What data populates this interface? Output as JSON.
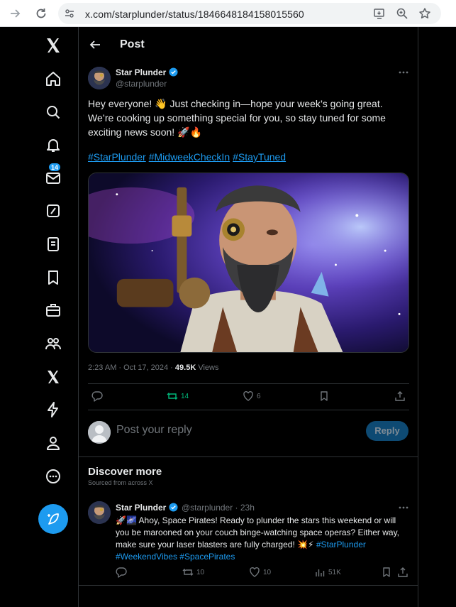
{
  "browser": {
    "url": "x.com/starplunder/status/1846648184158015560"
  },
  "sidebar": {
    "notification_count": "14"
  },
  "header": {
    "title": "Post"
  },
  "post": {
    "display_name": "Star Plunder",
    "handle": "@starplunder",
    "text": "Hey everyone! 👋 Just checking in—hope your week’s going great. We’re cooking up something special for you, so stay tuned for some exciting news soon! 🚀🔥",
    "hashtags": [
      "#StarPlunder",
      "#MidweekCheckIn",
      "#StayTuned"
    ],
    "timestamp": "2:23 AM · Oct 17, 2024 · ",
    "views_count": "49.5K",
    "views_label": " Views",
    "retweets": "14",
    "likes": "6"
  },
  "reply_box": {
    "placeholder": "Post your reply",
    "button": "Reply"
  },
  "discover": {
    "title": "Discover more",
    "subtitle": "Sourced from across X"
  },
  "related": {
    "display_name": "Star Plunder",
    "handle_time": "@starplunder · 23h",
    "text": "🚀🌌 Ahoy, Space Pirates! Ready to plunder the stars this weekend or will you be marooned on your couch binge-watching space operas? Either way, make sure your laser blasters are fully charged! 💥⚡ ",
    "tags": "#StarPlunder #WeekendVibes #SpacePirates",
    "retweets": "10",
    "likes": "10",
    "views": "51K"
  },
  "colors": {
    "accent": "#1d9bf0",
    "retweet_active": "#00ba7c",
    "border": "#2f3336",
    "muted": "#71767b"
  }
}
